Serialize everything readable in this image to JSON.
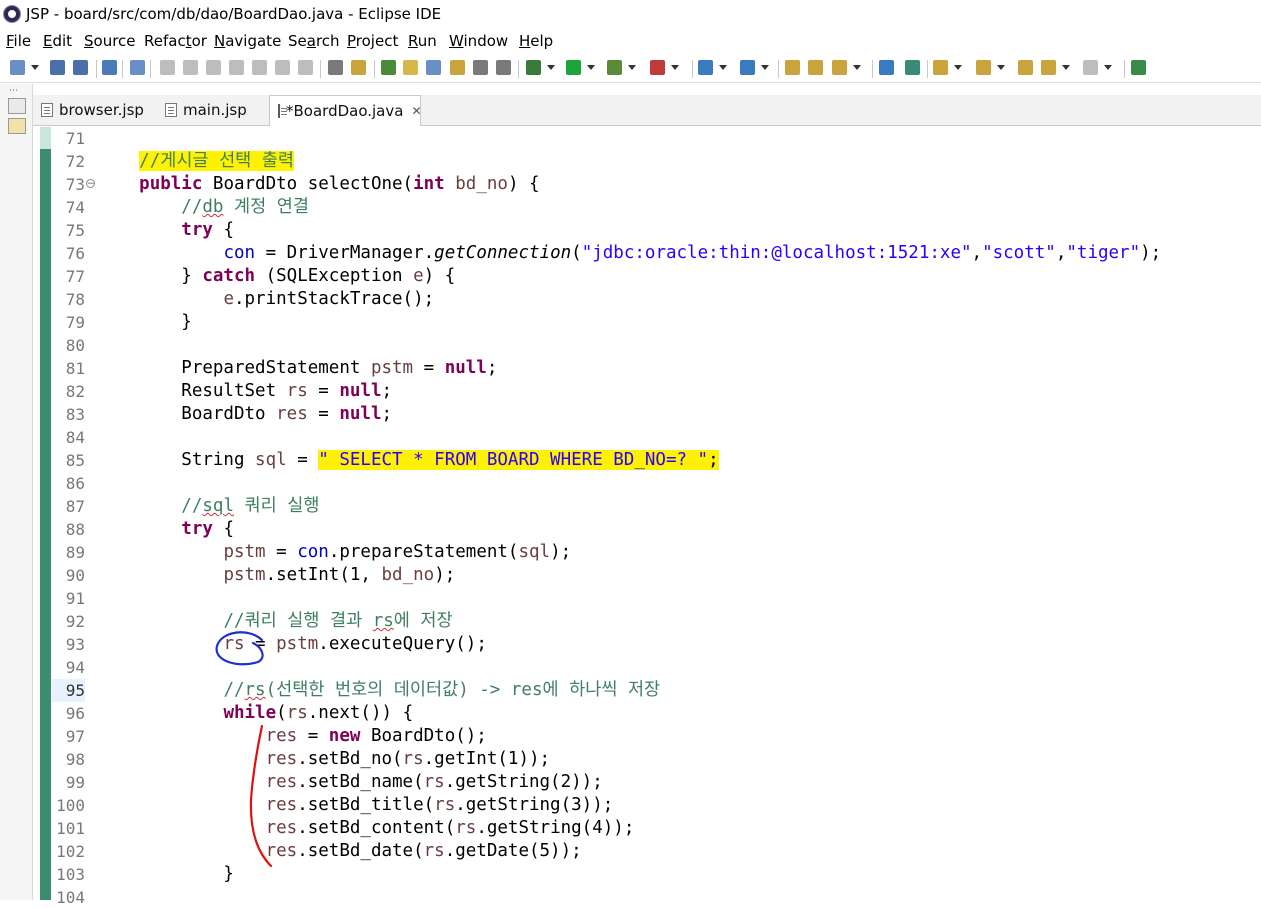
{
  "window": {
    "title": "JSP - board/src/com/db/dao/BoardDao.java - Eclipse IDE"
  },
  "menu": [
    {
      "mn": "F",
      "rest": "ile"
    },
    {
      "mn": "E",
      "rest": "dit"
    },
    {
      "mn": "S",
      "rest": "ource"
    },
    {
      "mn": "",
      "rest": "Refac",
      "mn2": "t",
      "rest2": "or"
    },
    {
      "mn": "N",
      "rest": "avigate"
    },
    {
      "mn": "",
      "rest": "Se",
      "mn2": "a",
      "rest2": "rch"
    },
    {
      "mn": "P",
      "rest": "roject"
    },
    {
      "mn": "R",
      "rest": "un"
    },
    {
      "mn": "W",
      "rest": "indow"
    },
    {
      "mn": "H",
      "rest": "elp"
    }
  ],
  "tabs": [
    {
      "label": "browser.jsp",
      "active": false
    },
    {
      "label": "main.jsp",
      "active": false
    },
    {
      "label": "*BoardDao.java",
      "active": true,
      "close": "✕"
    }
  ],
  "editor": {
    "current_line": "95",
    "lines": [
      {
        "n": "71",
        "html": ""
      },
      {
        "n": "72",
        "html": "    <span class=\"cm hl\">//게시글 선택 출력</span>"
      },
      {
        "n": "73",
        "fold": true,
        "html": "    <span class=\"kw\">public</span> BoardDto selectOne(<span class=\"kw\">int</span> <span class=\"var\">bd_no</span>) {"
      },
      {
        "n": "74",
        "html": "        <span class=\"cm\">//<span class=\"squig\">db</span> 계정 연결</span>"
      },
      {
        "n": "75",
        "html": "        <span class=\"kw\">try</span> {"
      },
      {
        "n": "76",
        "html": "            <span class=\"fld\">con</span> = DriverManager.<span class=\"mth\">getConnection</span>(<span class=\"str\">\"jdbc:oracle:thin:@localhost:1521:xe\"</span>,<span class=\"str\">\"scott\"</span>,<span class=\"str\">\"tiger\"</span>);"
      },
      {
        "n": "77",
        "html": "        } <span class=\"kw\">catch</span> (SQLException <span class=\"var\">e</span>) {"
      },
      {
        "n": "78",
        "html": "            <span class=\"var\">e</span>.printStackTrace();"
      },
      {
        "n": "79",
        "html": "        }"
      },
      {
        "n": "80",
        "html": ""
      },
      {
        "n": "81",
        "html": "        PreparedStatement <span class=\"var\">pstm</span> = <span class=\"kw\">null</span>;"
      },
      {
        "n": "82",
        "html": "        ResultSet <span class=\"var\">rs</span> = <span class=\"kw\">null</span>;"
      },
      {
        "n": "83",
        "html": "        BoardDto <span class=\"var\">res</span> = <span class=\"kw\">null</span>;"
      },
      {
        "n": "84",
        "html": ""
      },
      {
        "n": "85",
        "html": "        String <span class=\"var\">sql</span> = <span class=\"str hl\">\" SELECT * FROM BOARD WHERE BD_NO=? \"</span><span class=\"hl\">;</span>"
      },
      {
        "n": "86",
        "html": ""
      },
      {
        "n": "87",
        "html": "        <span class=\"cm\">//<span class=\"squig\">sql</span> 쿼리 실행</span>"
      },
      {
        "n": "88",
        "html": "        <span class=\"kw\">try</span> {"
      },
      {
        "n": "89",
        "html": "            <span class=\"var\">pstm</span> = <span class=\"fld\">con</span>.prepareStatement(<span class=\"var\">sql</span>);"
      },
      {
        "n": "90",
        "html": "            <span class=\"var\">pstm</span>.setInt(1, <span class=\"var\">bd_no</span>);"
      },
      {
        "n": "91",
        "html": ""
      },
      {
        "n": "92",
        "html": "            <span class=\"cm\">//쿼리 실행 결과 <span class=\"squig\">rs</span>에 저장</span>"
      },
      {
        "n": "93",
        "html": "            <span class=\"var\">rs</span> = <span class=\"var\">pstm</span>.executeQuery();"
      },
      {
        "n": "94",
        "html": ""
      },
      {
        "n": "95",
        "html": "            <span class=\"cm\">//<span class=\"squig\">rs</span>(선택한 번호의 데이터값) -&gt; res에 하나씩 저장</span>"
      },
      {
        "n": "96",
        "html": "            <span class=\"kw\">while</span>(<span class=\"var\">rs</span>.next()) {"
      },
      {
        "n": "97",
        "html": "                <span class=\"var\">res</span> = <span class=\"kw\">new</span> BoardDto();"
      },
      {
        "n": "98",
        "html": "                <span class=\"var\">res</span>.setBd_no(<span class=\"var\">rs</span>.getInt(1));"
      },
      {
        "n": "99",
        "html": "                <span class=\"var\">res</span>.setBd_name(<span class=\"var\">rs</span>.getString(2));"
      },
      {
        "n": "100",
        "html": "                <span class=\"var\">res</span>.setBd_title(<span class=\"var\">rs</span>.getString(3));"
      },
      {
        "n": "101",
        "html": "                <span class=\"var\">res</span>.setBd_content(<span class=\"var\">rs</span>.getString(4));"
      },
      {
        "n": "102",
        "html": "                <span class=\"var\">res</span>.setBd_date(<span class=\"var\">rs</span>.getDate(5));"
      },
      {
        "n": "103",
        "html": "            }"
      },
      {
        "n": "104",
        "html": ""
      }
    ]
  },
  "colors": {
    "keyword": "#7f0055",
    "comment": "#3f7f5f",
    "string": "#2a00ff",
    "field": "#0000c0",
    "local_var": "#6a3e3e",
    "highlight": "#fff200",
    "ink_blue": "#1f2fd0",
    "ink_red": "#e01010"
  }
}
